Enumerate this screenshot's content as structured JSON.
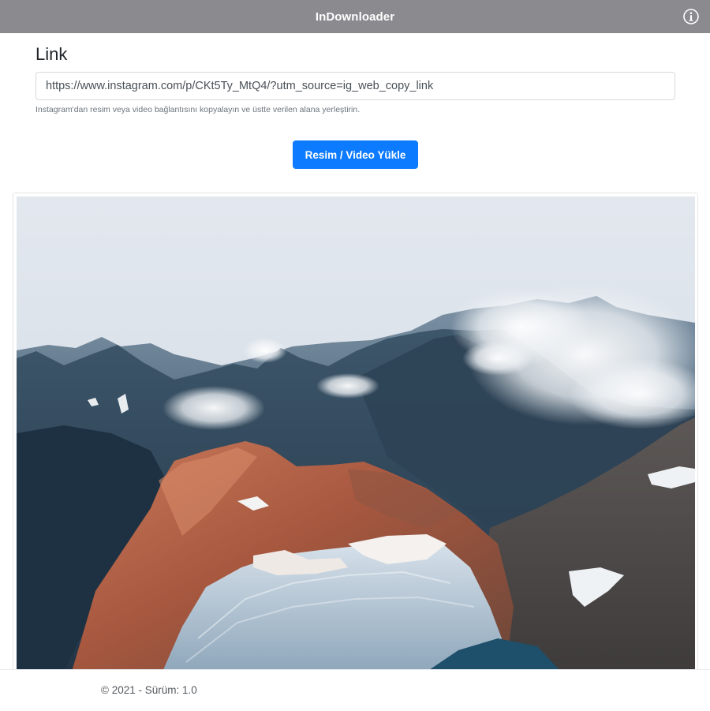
{
  "app": {
    "title": "InDownloader"
  },
  "form": {
    "label": "Link",
    "url_value": "https://www.instagram.com/p/CKt5Ty_MtQ4/?utm_source=ig_web_copy_link",
    "hint": "Instagram'dan resim veya video bağlantısını kopyalayın ve üstte verilen alana yerleştirin.",
    "button_label": "Resim / Video Yükle"
  },
  "preview": {
    "subject": "aerial mountain landscape with clouds"
  },
  "footer": {
    "text": "© 2021 - Sürüm: 1.0"
  },
  "colors": {
    "titlebar": "#8a8a8f",
    "primary": "#0d7bff"
  },
  "icons": {
    "info": "info-icon"
  }
}
